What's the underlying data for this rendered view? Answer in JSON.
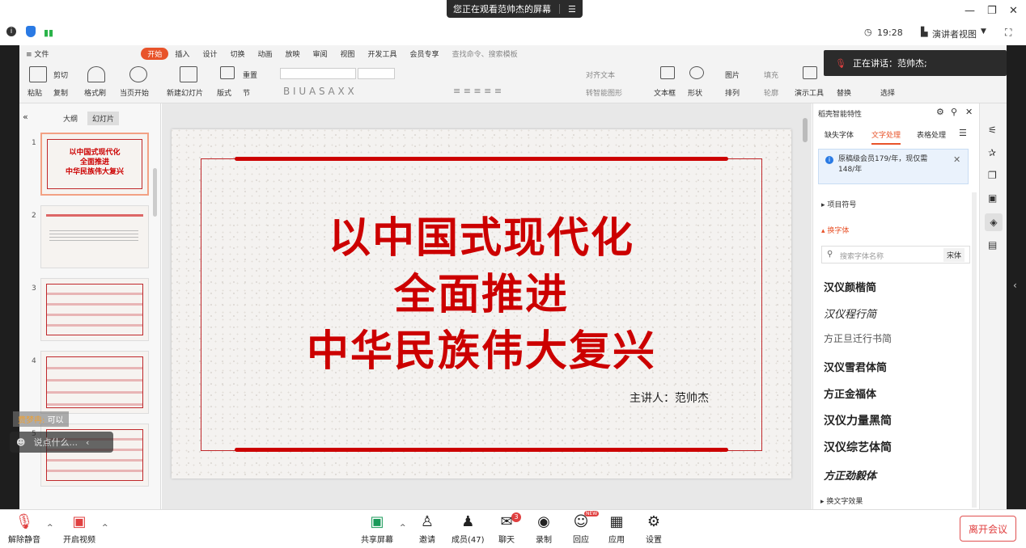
{
  "banner": {
    "text": "您正在观看范帅杰的屏幕"
  },
  "status": {
    "time": "19:28",
    "view": "演讲者视图"
  },
  "menu": [
    "≡ 文件",
    "开始",
    "插入",
    "设计",
    "切换",
    "动画",
    "放映",
    "审阅",
    "视图",
    "开发工具",
    "会员专享",
    "查找命令、搜索模板"
  ],
  "ribbon": {
    "paste": "粘贴",
    "cut": "剪切",
    "copy": "复制",
    "format_painter": "格式刷",
    "from_current": "当页开始",
    "new_slide": "新建幻灯片",
    "layout": "版式",
    "section": "节",
    "reset": "重置",
    "text_box": "文本框",
    "shape": "形状",
    "picture": "图片",
    "fill": "填充",
    "arrange": "排列",
    "outline": "轮廓",
    "presenter_tools": "演示工具",
    "replace": "替换",
    "select": "选择",
    "align_text": "对齐文本",
    "smart_graphic": "转智能图形"
  },
  "speaking": {
    "text": "正在讲话：范帅杰;"
  },
  "leftpane": {
    "tab_outline": "大纲",
    "tab_slides": "幻灯片",
    "thumbs": [
      {
        "num": "1",
        "lines": [
          "以中国式现代化",
          "全面推进",
          "中华民族伟大复兴"
        ]
      },
      {
        "num": "2"
      },
      {
        "num": "3"
      },
      {
        "num": "4"
      },
      {
        "num": "5"
      }
    ]
  },
  "slide": {
    "line1": "以中国式现代化",
    "line2": "全面推进",
    "line3": "中华民族伟大复兴",
    "presenter": "主讲人：范帅杰"
  },
  "rightpane": {
    "title": "稻壳智能特性",
    "tabs": [
      "缺失字体",
      "文字处理",
      "表格处理"
    ],
    "promo": "原稿级会员179/年，现仅需148/年",
    "section1": "项目符号",
    "section2": "换字体",
    "search_placeholder": "搜索字体名称",
    "current_font": "宋体",
    "fonts": [
      "汉仪颜楷简",
      "汉仪程行简",
      "方正旦迁行书简",
      "汉仪雪君体简",
      "方正金福体",
      "汉仪力量黑简",
      "汉仪综艺体简",
      "方正劲毅体"
    ],
    "section3": "换文字效果"
  },
  "chat": {
    "name": "费梦冉:",
    "msg": "可以",
    "placeholder": "说点什么..."
  },
  "bottom": {
    "mute": "解除静音",
    "video": "开启视频",
    "share": "共享屏幕",
    "invite": "邀请",
    "members": "成员(47)",
    "chat": "聊天",
    "chat_badge": "3",
    "record": "录制",
    "reaction": "回应",
    "reaction_badge": "NEW",
    "apps": "应用",
    "settings": "设置",
    "leave": "离开会议"
  }
}
